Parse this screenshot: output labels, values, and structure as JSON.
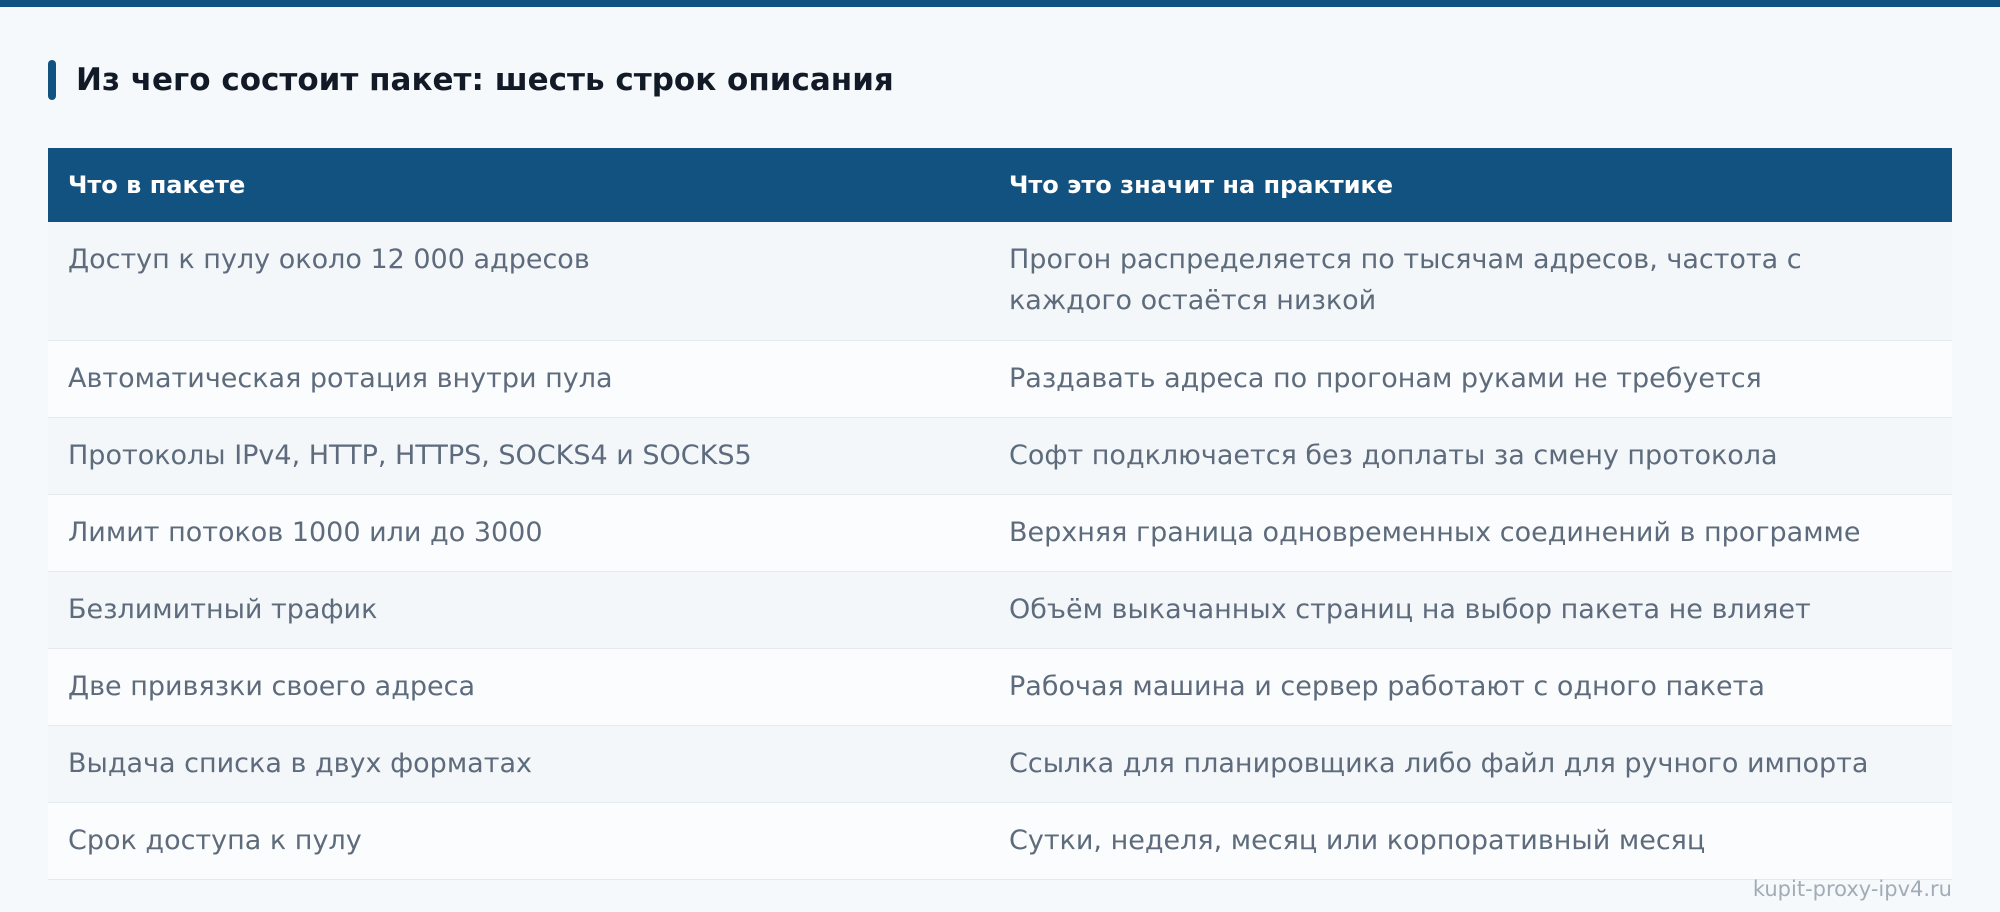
{
  "heading": {
    "title": "Из чего состоит пакет: шесть строк описания"
  },
  "table": {
    "headers": [
      "Что в пакете",
      "Что это значит на практике"
    ],
    "rows": [
      [
        "Доступ к пулу около 12 000 адресов",
        "Прогон распределяется по тысячам адресов, частота с каждого остаётся низкой"
      ],
      [
        "Автоматическая ротация внутри пула",
        "Раздавать адреса по прогонам руками не требуется"
      ],
      [
        "Протоколы IPv4, HTTP, HTTPS, SOCKS4 и SOCKS5",
        "Софт подключается без доплаты за смену протокола"
      ],
      [
        "Лимит потоков 1000 или до 3000",
        "Верхняя граница одновременных соединений в программе"
      ],
      [
        "Безлимитный трафик",
        "Объём выкачанных страниц на выбор пакета не влияет"
      ],
      [
        "Две привязки своего адреса",
        "Рабочая машина и сервер работают с одного пакета"
      ],
      [
        "Выдача списка в двух форматах",
        "Ссылка для планировщика либо файл для ручного импорта"
      ],
      [
        "Срок доступа к пулу",
        "Сутки, неделя, месяц или корпоративный месяц"
      ]
    ]
  },
  "watermark": "kupit-proxy-ipv4.ru",
  "colors": {
    "accent": "#125280",
    "background": "#f6f9fc",
    "row_odd": "#f4f7fa",
    "row_even": "#fbfcfd",
    "body_text": "#5d6b7c",
    "heading_text": "#111a26",
    "watermark_text": "#a2acb7"
  }
}
